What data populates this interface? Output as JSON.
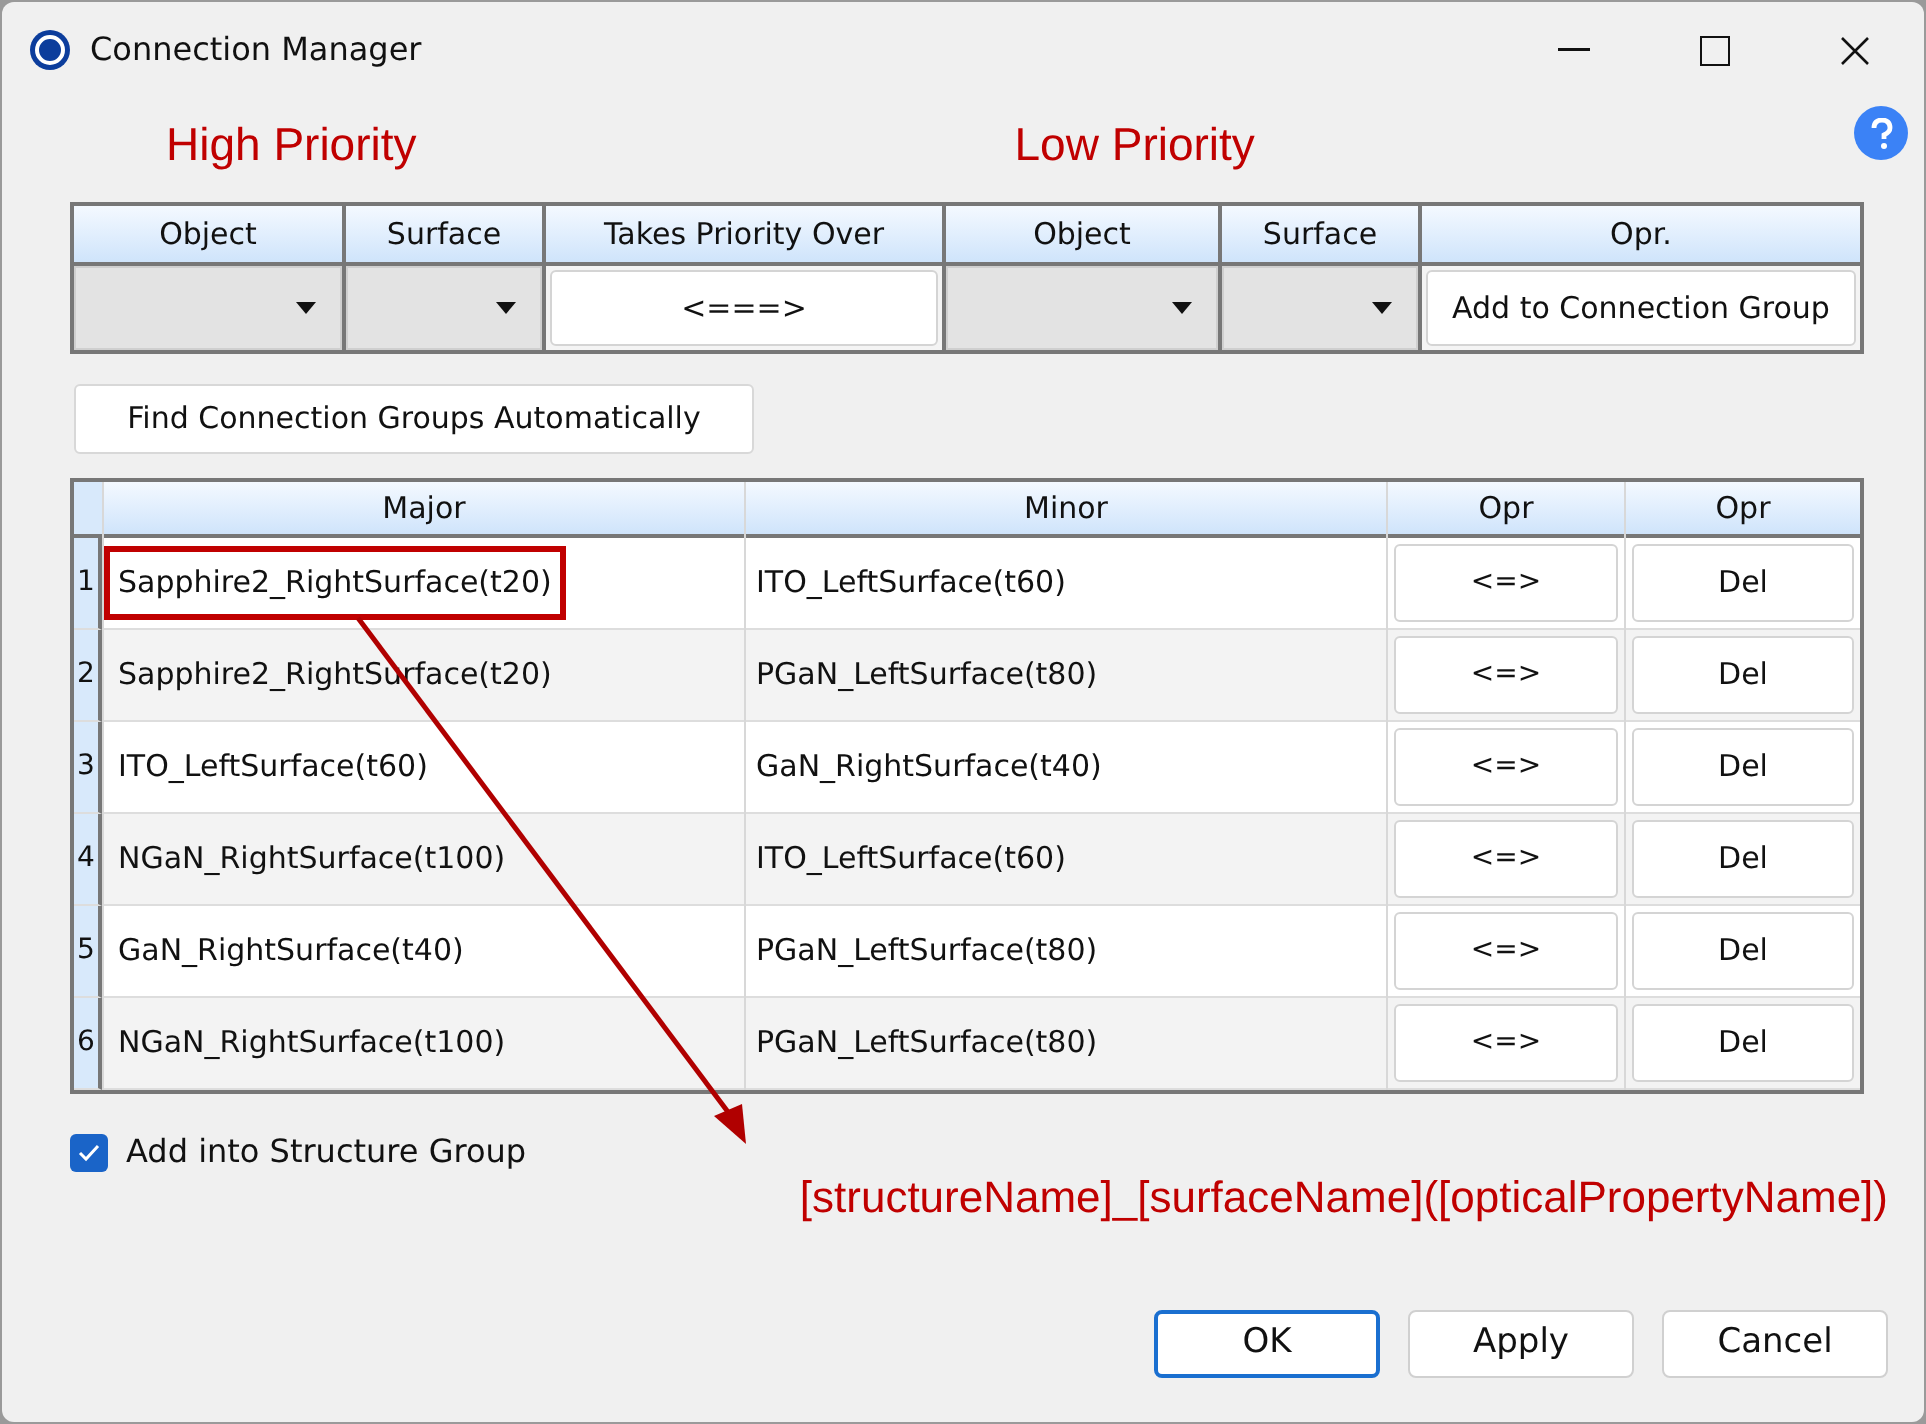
{
  "window": {
    "title": "Connection Manager"
  },
  "priority_labels": {
    "high": "High Priority",
    "low": "Low Priority"
  },
  "connection_editor": {
    "columns": [
      "Object",
      "Surface",
      "Takes Priority Over",
      "Object",
      "Surface",
      "Opr."
    ],
    "cells": [
      {
        "kind": "dropdown"
      },
      {
        "kind": "dropdown"
      },
      {
        "kind": "button",
        "label": "<===>"
      },
      {
        "kind": "dropdown"
      },
      {
        "kind": "dropdown"
      },
      {
        "kind": "button",
        "label": "Add to Connection Group"
      }
    ]
  },
  "find_button": "Find Connection Groups Automatically",
  "table": {
    "columns": [
      "Major",
      "Minor",
      "Opr",
      "Opr"
    ],
    "rows": [
      {
        "index": "1",
        "major": "Sapphire2_RightSurface(t20)",
        "minor": "ITO_LeftSurface(t60)",
        "swap": "<=>",
        "delete": "Del",
        "highlighted": true
      },
      {
        "index": "2",
        "major": "Sapphire2_RightSurface(t20)",
        "minor": "PGaN_LeftSurface(t80)",
        "swap": "<=>",
        "delete": "Del",
        "highlighted": false
      },
      {
        "index": "3",
        "major": "ITO_LeftSurface(t60)",
        "minor": "GaN_RightSurface(t40)",
        "swap": "<=>",
        "delete": "Del",
        "highlighted": false
      },
      {
        "index": "4",
        "major": "NGaN_RightSurface(t100)",
        "minor": "ITO_LeftSurface(t60)",
        "swap": "<=>",
        "delete": "Del",
        "highlighted": false
      },
      {
        "index": "5",
        "major": "GaN_RightSurface(t40)",
        "minor": "PGaN_LeftSurface(t80)",
        "swap": "<=>",
        "delete": "Del",
        "highlighted": false
      },
      {
        "index": "6",
        "major": "NGaN_RightSurface(t100)",
        "minor": "PGaN_LeftSurface(t80)",
        "swap": "<=>",
        "delete": "Del",
        "highlighted": false
      }
    ]
  },
  "structure_group": {
    "label": "Add into Structure Group",
    "checked": true
  },
  "annotation": "[structureName]_[surfaceName]([opticalPropertyName])",
  "buttons": [
    {
      "label": "OK",
      "selected": true
    },
    {
      "label": "Apply",
      "selected": false
    },
    {
      "label": "Cancel",
      "selected": false
    }
  ]
}
